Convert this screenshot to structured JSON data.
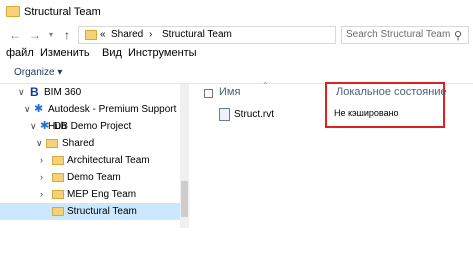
{
  "window": {
    "title": "Structural Team"
  },
  "nav": {
    "back_icon": "arrow-left-icon",
    "forward_icon": "arrow-right-icon",
    "recent_icon": "chevron-down-icon",
    "up_icon": "arrow-up-icon",
    "breadcrumb": {
      "overflow": "«",
      "shared": "Shared",
      "sep": "›",
      "current": "Structural Team"
    },
    "search_placeholder": "Search Structural Team"
  },
  "menu": {
    "items": [
      "файл",
      "Изменить",
      "Вид",
      "Инструменты"
    ]
  },
  "toolbar": {
    "organize": "Organize ▾"
  },
  "tree": {
    "items": [
      {
        "label": "BIM 360",
        "icon": "bim360-logo-icon"
      },
      {
        "label": "Autodesk - Premium Support Hub",
        "icon": "hub-icon"
      },
      {
        "label": "DB Demo Project",
        "icon": "project-icon"
      },
      {
        "label": "Shared",
        "icon": "folder-icon"
      },
      {
        "label": "Architectural Team",
        "icon": "folder-icon"
      },
      {
        "label": "Demo Team",
        "icon": "folder-icon"
      },
      {
        "label": "MEP Eng Team",
        "icon": "folder-icon"
      },
      {
        "label": "Structural Team",
        "icon": "folder-icon",
        "selected": true
      }
    ]
  },
  "list": {
    "column_name": "Имя",
    "files": [
      {
        "name": "Struct.rvt",
        "icon": "revit-file-icon"
      }
    ]
  },
  "status_popup": {
    "header": "Локальное состояние",
    "value": "Не кэшировано"
  }
}
